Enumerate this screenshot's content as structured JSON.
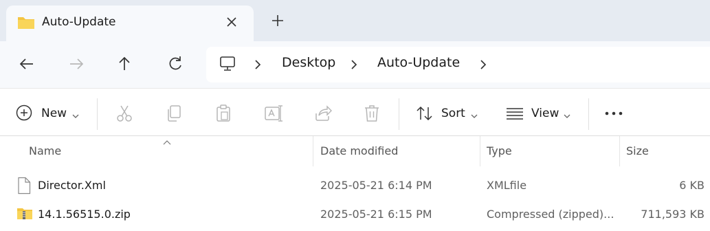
{
  "tab": {
    "title": "Auto-Update",
    "icon": "folder-icon"
  },
  "navigation": {
    "back": "back-arrow-icon",
    "forward": "forward-arrow-icon",
    "up": "up-arrow-icon",
    "refresh": "refresh-icon"
  },
  "breadcrumb": {
    "items": [
      "Desktop",
      "Auto-Update"
    ],
    "root_icon": "this-pc-icon"
  },
  "commandbar": {
    "new_label": "New",
    "sort_label": "Sort",
    "view_label": "View",
    "icons": [
      "cut-icon",
      "copy-icon",
      "paste-icon",
      "rename-icon",
      "share-icon",
      "delete-icon",
      "more-icon"
    ]
  },
  "columns": {
    "name": "Name",
    "date": "Date modified",
    "type": "Type",
    "size": "Size"
  },
  "files": [
    {
      "name": "Director.Xml",
      "date": "2025-05-21 6:14 PM",
      "type": "XMLfile",
      "size": "6 KB",
      "icon": "document-icon"
    },
    {
      "name": "14.1.56515.0.zip",
      "date": "2025-05-21 6:15 PM",
      "type": "Compressed (zipped)...",
      "size": "711,593 KB",
      "icon": "zip-folder-icon"
    }
  ],
  "colors": {
    "tabstrip": "#e6ebf2",
    "navbar": "#f7f9fc",
    "folder": "#f4c542",
    "accent": "#0067c0"
  }
}
